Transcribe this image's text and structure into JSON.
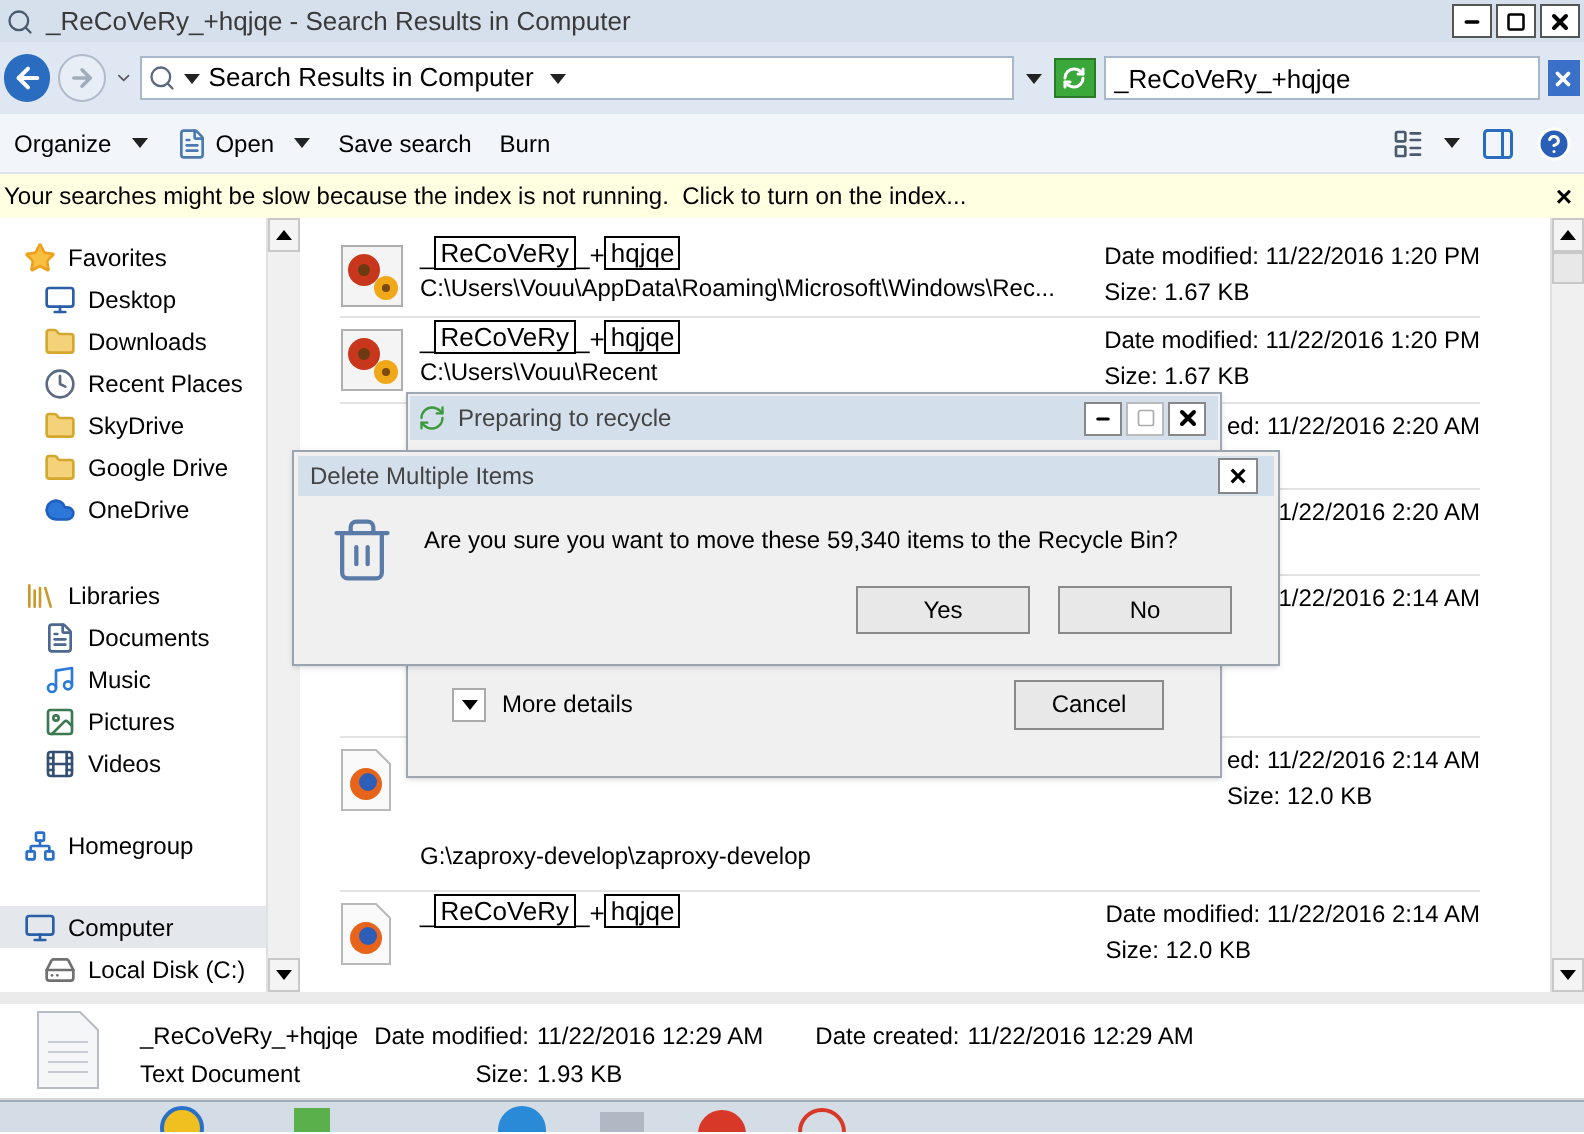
{
  "window": {
    "title": "_ReCoVeRy_+hqjqe - Search Results in Computer"
  },
  "address_bar": {
    "location": "Search Results in Computer"
  },
  "search": {
    "value": "_ReCoVeRy_+hqjqe"
  },
  "toolbar": {
    "items": [
      {
        "label": "Organize",
        "has_menu": true
      },
      {
        "label": "Open",
        "has_menu": true
      },
      {
        "label": "Save search",
        "has_menu": false
      },
      {
        "label": "Burn",
        "has_menu": false
      }
    ]
  },
  "info_bar": {
    "message": "Your searches might be slow because the index is not running.  Click to turn on the index...",
    "close": "×"
  },
  "sidebar": {
    "groups": [
      {
        "label": "Favorites",
        "selected": false,
        "children": [
          {
            "label": "Desktop",
            "selected": false
          },
          {
            "label": "Downloads",
            "selected": false
          },
          {
            "label": "Recent Places",
            "selected": false
          },
          {
            "label": "SkyDrive",
            "selected": false
          },
          {
            "label": "Google Drive",
            "selected": false
          },
          {
            "label": "OneDrive",
            "selected": false
          }
        ]
      },
      {
        "label": "Libraries",
        "selected": false,
        "children": [
          {
            "label": "Documents",
            "selected": false
          },
          {
            "label": "Music",
            "selected": false
          },
          {
            "label": "Pictures",
            "selected": false
          },
          {
            "label": "Videos",
            "selected": false
          }
        ]
      },
      {
        "label": "Homegroup",
        "selected": false
      },
      {
        "label": "Computer",
        "selected": true,
        "children": [
          {
            "label": "Local Disk (C:)",
            "selected": false
          }
        ]
      }
    ]
  },
  "results": [
    {
      "name_parts": [
        {
          "text": "_",
          "highlighted": false
        },
        {
          "text": "ReCoVeRy",
          "highlighted": true
        },
        {
          "text": "_+",
          "highlighted": false
        },
        {
          "text": "hqjqe",
          "highlighted": true
        }
      ],
      "path": "C:\\Users\\Vouu\\AppData\\Roaming\\Microsoft\\Windows\\Rec...",
      "date": "Date modified: 11/22/2016 1:20 PM",
      "size": "Size: 1.67 KB"
    },
    {
      "name_parts": [
        {
          "text": "_",
          "highlighted": false
        },
        {
          "text": "ReCoVeRy",
          "highlighted": true
        },
        {
          "text": "_+",
          "highlighted": false
        },
        {
          "text": "hqjqe",
          "highlighted": true
        }
      ],
      "path": "C:\\Users\\Vouu\\Recent",
      "date": "Date modified: 11/22/2016 1:20 PM",
      "size": "Size: 1.67 KB"
    },
    {
      "date": "ed: 11/22/2016 2:20 AM"
    },
    {
      "date": "1/22/2016 2:20 AM"
    },
    {
      "date": "1/22/2016 2:14 AM"
    },
    {
      "path": "G:\\zaproxy-develop\\zaproxy-develop",
      "date": "ed: 11/22/2016 2:14 AM",
      "size": "Size: 12.0 KB"
    },
    {
      "name_parts": [
        {
          "text": "_",
          "highlighted": false
        },
        {
          "text": "ReCoVeRy",
          "highlighted": true
        },
        {
          "text": "_+",
          "highlighted": false
        },
        {
          "text": "hqjqe",
          "highlighted": true
        }
      ],
      "date": "Date modified: 11/22/2016 2:14 AM",
      "size": "Size: 12.0 KB"
    }
  ],
  "details_pane": {
    "name": "_ReCoVeRy_+hqjqe",
    "type": "Text Document",
    "modified_label": "Date modified:",
    "modified": "11/22/2016 12:29 AM",
    "size_label": "Size:",
    "size": "1.93 KB",
    "created_label": "Date created:",
    "created": "11/22/2016 12:29 AM"
  },
  "progress_dialog": {
    "title": "Preparing to recycle",
    "more_details": "More details",
    "cancel": "Cancel"
  },
  "confirm_dialog": {
    "title": "Delete Multiple Items",
    "message": "Are you sure you want to move these 59,340 items to the Recycle Bin?",
    "buttons": [
      "Yes",
      "No"
    ],
    "close": "×"
  }
}
